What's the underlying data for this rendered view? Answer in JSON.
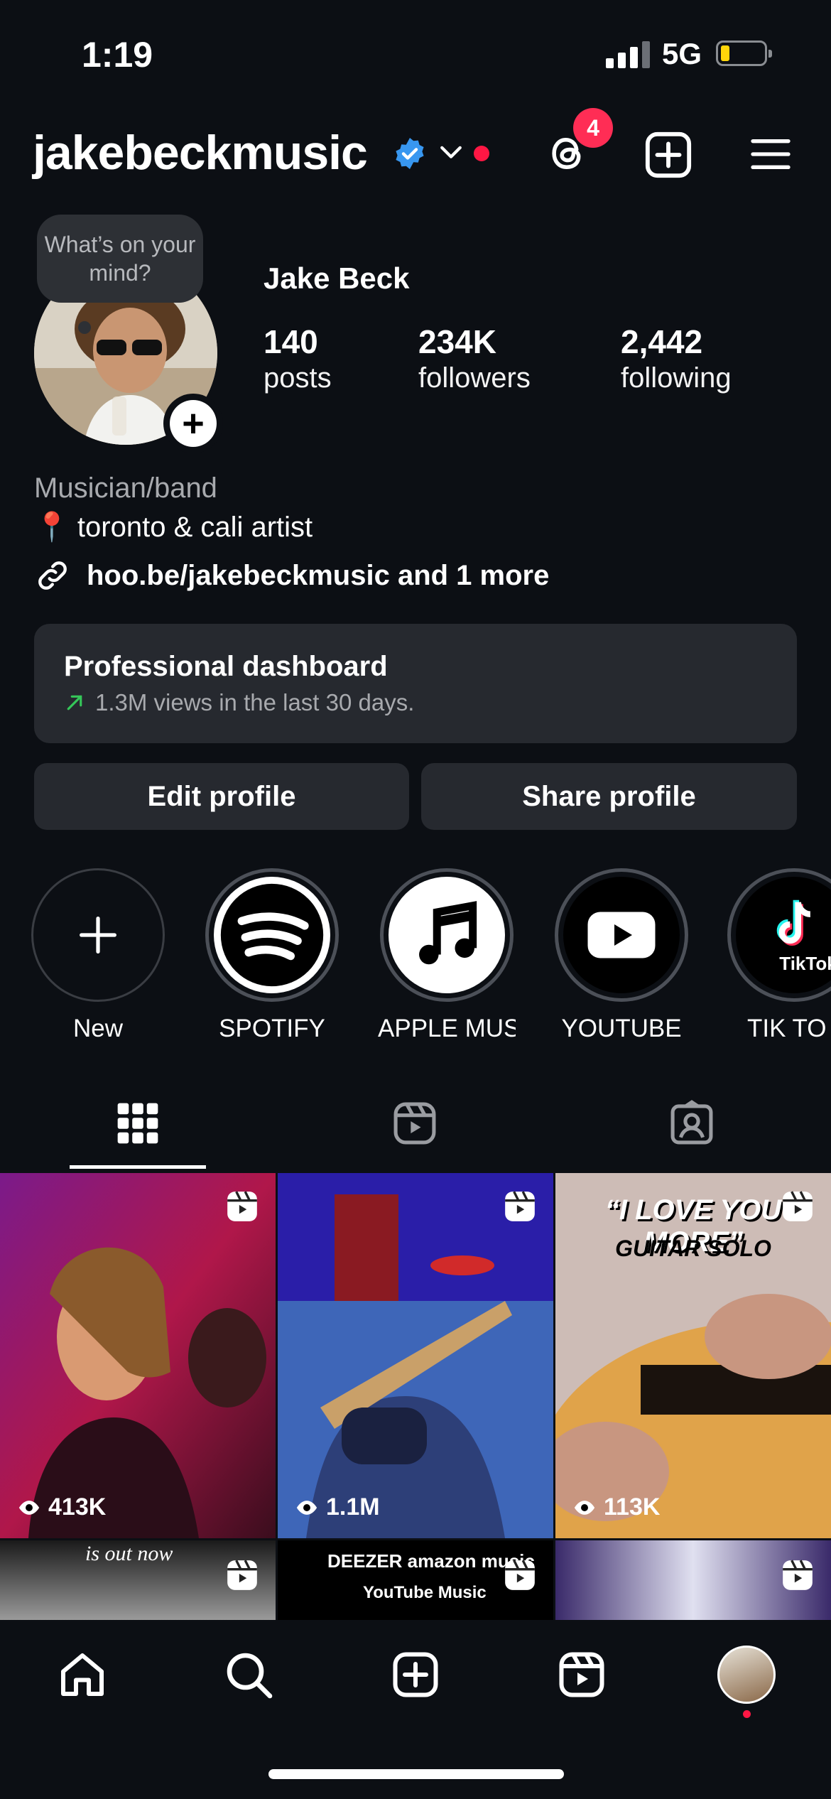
{
  "status": {
    "time": "1:19",
    "network": "5G"
  },
  "header": {
    "username": "jakebeckmusic",
    "threads_badge": "4"
  },
  "profile": {
    "note_bubble": "What’s on your mind?",
    "name": "Jake Beck",
    "stats": [
      {
        "num": "140",
        "label": "posts"
      },
      {
        "num": "234K",
        "label": "followers"
      },
      {
        "num": "2,442",
        "label": "following"
      }
    ],
    "category": "Musician/band",
    "location": "📍 toronto & cali artist",
    "link": "hoo.be/jakebeckmusic and 1 more"
  },
  "dashboard": {
    "title": "Professional dashboard",
    "subtitle": "1.3M views in the last 30 days."
  },
  "buttons": {
    "edit": "Edit profile",
    "share": "Share profile"
  },
  "highlights": [
    {
      "label": "New",
      "icon": "plus-icon"
    },
    {
      "label": "SPOTIFY",
      "icon": "spotify-icon"
    },
    {
      "label": "APPLE MUS...",
      "icon": "music-note-icon"
    },
    {
      "label": "YOUTUBE",
      "icon": "youtube-icon"
    },
    {
      "label": "TIK TO",
      "icon": "tiktok-icon",
      "logo_text": "TikTok"
    }
  ],
  "posts": [
    {
      "views": "413K"
    },
    {
      "views": "1.1M"
    },
    {
      "views": "113K",
      "overlay_title": "“I LOVE YOU MORE”",
      "overlay_sub": "GUITAR SOLO"
    }
  ],
  "posts_row2": [
    {
      "overlay": "is out now"
    },
    {
      "overlay_top": "DEEZER amazon music",
      "overlay_bottom": "YouTube Music"
    },
    {}
  ],
  "colors": {
    "background": "#0c0f14",
    "card": "#26292f",
    "accent_red": "#ff1744",
    "verified": "#3897f0",
    "trend_green": "#35c759"
  }
}
